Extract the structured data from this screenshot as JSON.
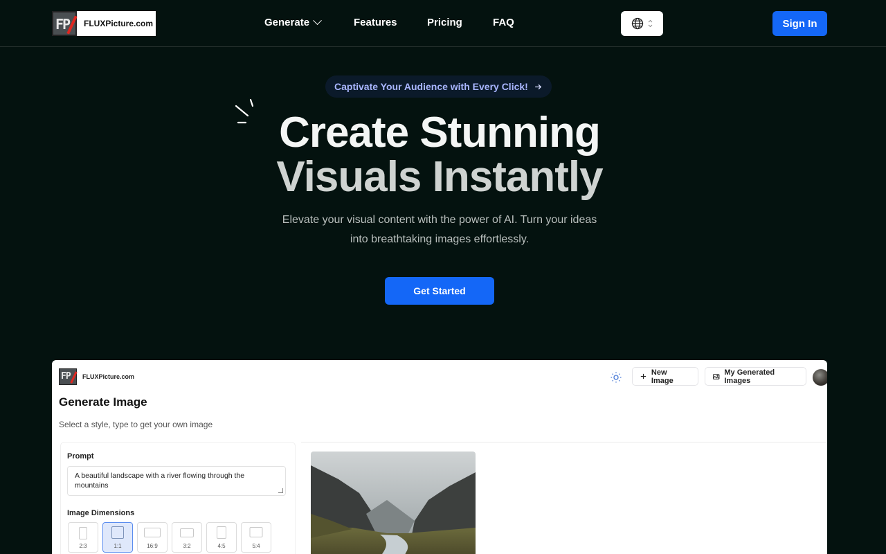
{
  "header": {
    "logo_text": "FLUXPicture.com",
    "logo_mark": "FP",
    "nav": {
      "generate": "Generate",
      "features": "Features",
      "pricing": "Pricing",
      "faq": "FAQ"
    },
    "lang_icon": "globe-icon",
    "signin": "Sign In"
  },
  "hero": {
    "pill": "Captivate Your Audience with Every Click!",
    "title_line1": "Create Stunning",
    "title_line2": "Visuals Instantly",
    "subtitle_line1": "Elevate your visual content with the power of AI. Turn your ideas",
    "subtitle_line2": "into breathtaking images effortlessly.",
    "cta": "Get Started"
  },
  "preview": {
    "logo_text": "FLUXPicture.com",
    "logo_mark": "FP",
    "new_image": "New Image",
    "my_images": "My Generated Images",
    "title": "Generate Image",
    "subtitle": "Select a style, type to get your own image",
    "prompt_label": "Prompt",
    "prompt_value": "A beautiful landscape with a river flowing through the mountains",
    "dimensions_label": "Image Dimensions",
    "dimensions": [
      {
        "label": "2:3",
        "selected": false
      },
      {
        "label": "1:1",
        "selected": true
      },
      {
        "label": "16:9",
        "selected": false
      },
      {
        "label": "3:2",
        "selected": false
      },
      {
        "label": "4:5",
        "selected": false
      },
      {
        "label": "5:4",
        "selected": false
      }
    ]
  },
  "colors": {
    "background": "#04120f",
    "accent": "#1467f7",
    "pill_text": "#a9b6ff"
  }
}
